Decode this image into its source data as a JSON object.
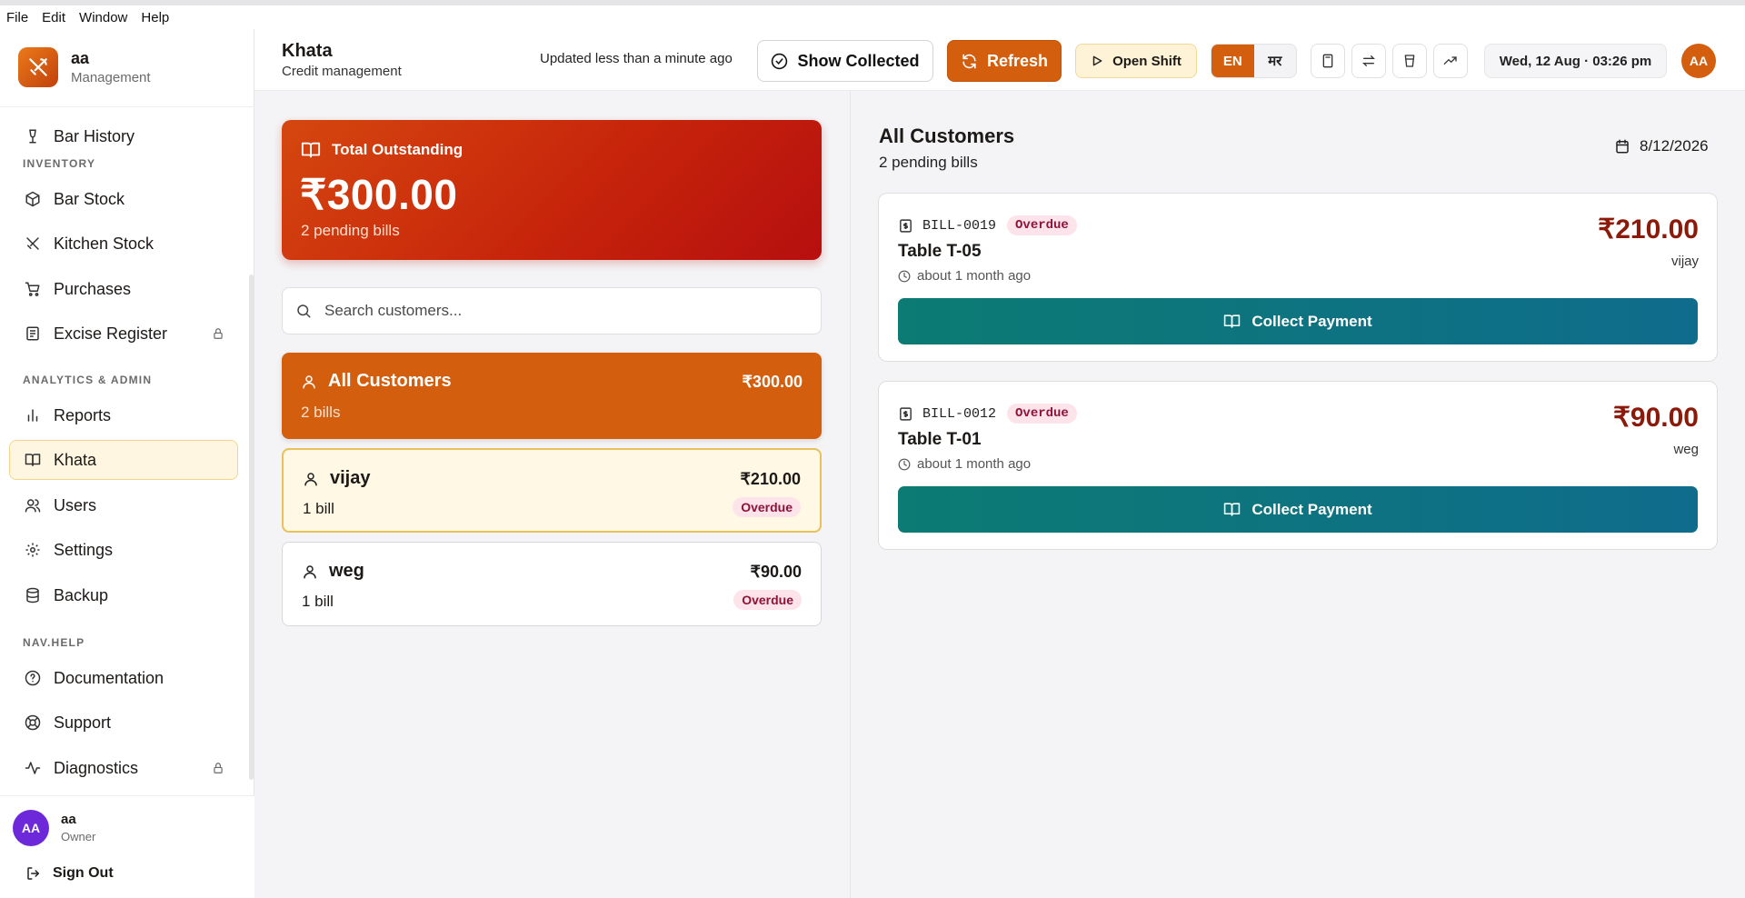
{
  "menubar": {
    "items": [
      "File",
      "Edit",
      "Window",
      "Help"
    ]
  },
  "brand": {
    "name": "aa",
    "subtitle": "Management",
    "icon": "utensils-icon"
  },
  "sidebar": {
    "bar_history": "Bar History",
    "sections": {
      "inventory": "INVENTORY",
      "analytics": "ANALYTICS & ADMIN",
      "help": "NAV.HELP"
    },
    "items": {
      "bar_stock": "Bar Stock",
      "kitchen_stock": "Kitchen Stock",
      "purchases": "Purchases",
      "excise_register": "Excise Register",
      "reports": "Reports",
      "khata": "Khata",
      "users": "Users",
      "settings": "Settings",
      "backup": "Backup",
      "documentation": "Documentation",
      "support": "Support",
      "diagnostics": "Diagnostics"
    },
    "active": "khata"
  },
  "user": {
    "initials": "AA",
    "name": "aa",
    "role": "Owner",
    "sign_out": "Sign Out"
  },
  "header": {
    "title": "Khata",
    "subtitle": "Credit management",
    "updated": "Updated less than a minute ago",
    "show_collected": "Show Collected",
    "refresh": "Refresh",
    "open_shift": "Open Shift",
    "lang_en": "EN",
    "lang_mr": "मर",
    "datetime": "Wed, 12 Aug · 03:26 pm",
    "avatar": "AA"
  },
  "summary": {
    "label": "Total Outstanding",
    "amount": "₹300.00",
    "bills": "2 pending bills"
  },
  "search": {
    "placeholder": "Search customers..."
  },
  "customers": [
    {
      "name": "All Customers",
      "amount": "₹300.00",
      "bills": "2 bills"
    },
    {
      "name": "vijay",
      "amount": "₹210.00",
      "bills": "1 bill",
      "status": "Overdue"
    },
    {
      "name": "weg",
      "amount": "₹90.00",
      "bills": "1 bill",
      "status": "Overdue"
    }
  ],
  "detail": {
    "title": "All Customers",
    "subtitle": "2 pending bills",
    "date": "8/12/2026",
    "bills": [
      {
        "id": "BILL-0019",
        "status": "Overdue",
        "table": "Table T-05",
        "time": "about 1 month ago",
        "amount": "₹210.00",
        "customer": "vijay",
        "action": "Collect Payment"
      },
      {
        "id": "BILL-0012",
        "status": "Overdue",
        "table": "Table T-01",
        "time": "about 1 month ago",
        "amount": "₹90.00",
        "customer": "weg",
        "action": "Collect Payment"
      }
    ]
  },
  "colors": {
    "accent": "#d35f0e",
    "danger": "#c7240b",
    "teal": "#0c7b73",
    "active_bg": "#fef6e1"
  }
}
